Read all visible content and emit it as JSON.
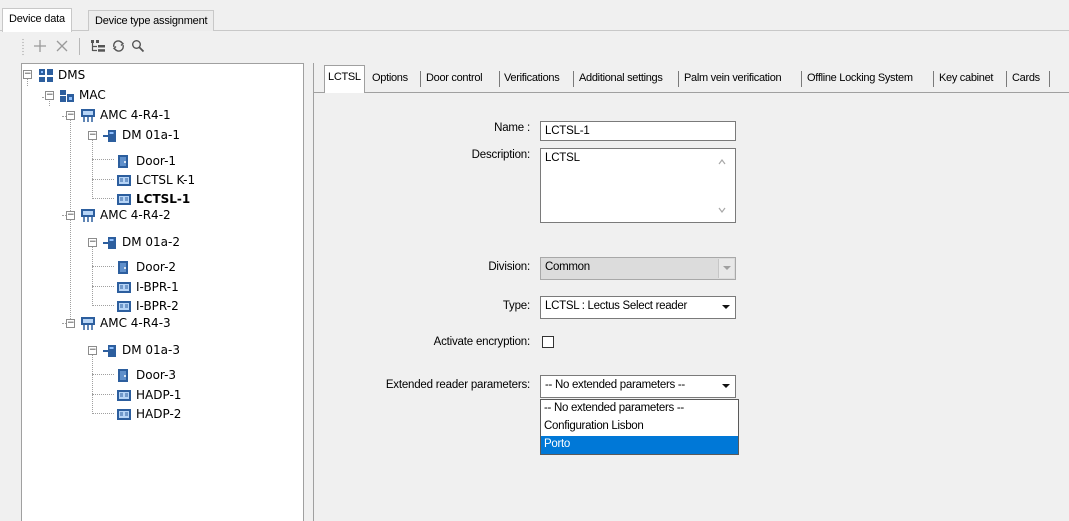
{
  "top_tabs": [
    {
      "label": "Device data",
      "active": true
    },
    {
      "label": "Device type assignment",
      "active": false
    }
  ],
  "toolbar": {
    "add_icon": "plus-icon",
    "delete_icon": "x-icon",
    "tree_icon": "tree-view-icon",
    "refresh_icon": "refresh-icon",
    "search_icon": "search-icon"
  },
  "tree": {
    "nodes": [
      {
        "label": "DMS",
        "icon": "dms-icon",
        "expanded": true
      },
      {
        "label": "MAC",
        "icon": "mac-icon",
        "expanded": true
      },
      {
        "label": "AMC 4-R4-1",
        "icon": "controller-icon",
        "expanded": true
      },
      {
        "label": "DM 01a-1",
        "icon": "door-module-icon",
        "expanded": true
      },
      {
        "label": "Door-1",
        "icon": "door-icon"
      },
      {
        "label": "LCTSL K-1",
        "icon": "reader-icon"
      },
      {
        "label": "LCTSL-1",
        "icon": "reader-icon",
        "selected": true
      },
      {
        "label": "AMC 4-R4-2",
        "icon": "controller-icon",
        "expanded": true
      },
      {
        "label": "DM 01a-2",
        "icon": "door-module-icon",
        "expanded": true
      },
      {
        "label": "Door-2",
        "icon": "door-icon"
      },
      {
        "label": "I-BPR-1",
        "icon": "reader-icon"
      },
      {
        "label": "I-BPR-2",
        "icon": "reader-icon"
      },
      {
        "label": "AMC 4-R4-3",
        "icon": "controller-icon",
        "expanded": true
      },
      {
        "label": "DM 01a-3",
        "icon": "door-module-icon",
        "expanded": true
      },
      {
        "label": "Door-3",
        "icon": "door-icon"
      },
      {
        "label": "HADP-1",
        "icon": "reader-icon"
      },
      {
        "label": "HADP-2",
        "icon": "reader-icon"
      }
    ]
  },
  "detail_tabs": [
    {
      "label": "LCTSL",
      "active": true
    },
    {
      "label": "Options"
    },
    {
      "label": "Door control"
    },
    {
      "label": "Verifications"
    },
    {
      "label": "Additional settings"
    },
    {
      "label": "Palm vein verification"
    },
    {
      "label": "Offline Locking System"
    },
    {
      "label": "Key cabinet"
    },
    {
      "label": "Cards"
    }
  ],
  "form": {
    "name_label": "Name :",
    "name_value": "LCTSL-1",
    "description_label": "Description:",
    "description_value": "LCTSL",
    "division_label": "Division:",
    "division_value": "Common",
    "type_label": "Type:",
    "type_value": "LCTSL : Lectus Select reader",
    "encryption_label": "Activate encryption:",
    "encryption_checked": false,
    "extended_label": "Extended reader parameters:",
    "extended_value": "-- No extended parameters --",
    "extended_options": [
      "-- No extended parameters --",
      "Configuration Lisbon",
      "Porto"
    ],
    "extended_highlighted": "Porto"
  },
  "colors": {
    "selection": "#0078d7",
    "window_bg": "#f0f0f0",
    "disabled_field": "#dcdcdc"
  }
}
